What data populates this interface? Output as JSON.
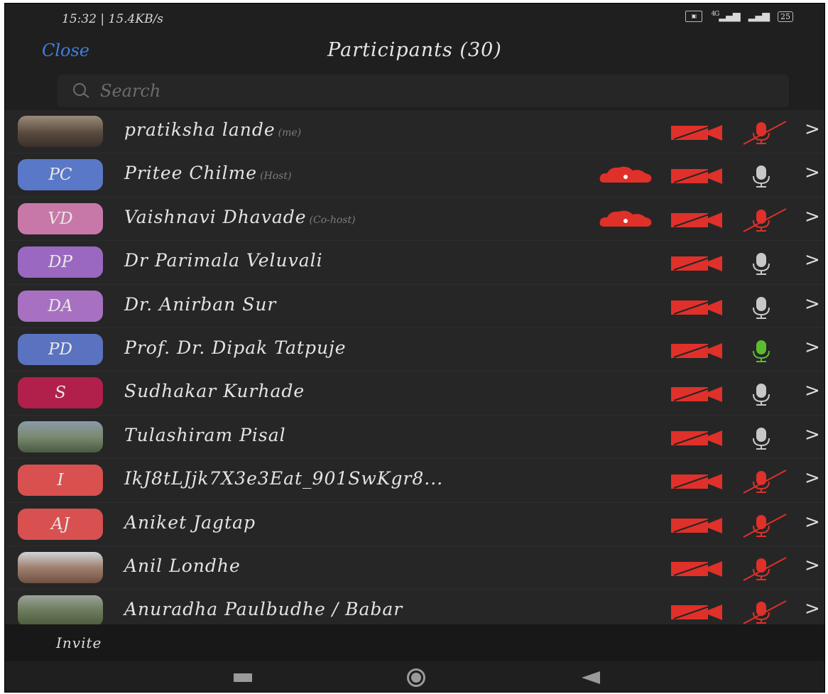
{
  "status_bar": {
    "time": "15:32 | 15.4KB/s",
    "network_label": "4G",
    "battery": "25"
  },
  "header": {
    "close_label": "Close",
    "title": "Participants (30)"
  },
  "search": {
    "placeholder": "Search"
  },
  "colors": {
    "accent_blue": "#3f7fe0",
    "muted_red": "#e0302a",
    "unmuted_gray": "#c8c8c8",
    "speaking_green": "#5bbd2e"
  },
  "participants": [
    {
      "initials": "",
      "avatar_color": "",
      "avatar_type": "photo",
      "name": "pratiksha lande",
      "role": "(me)",
      "recording": false,
      "mic": "muted"
    },
    {
      "initials": "PC",
      "avatar_color": "#5a78c8",
      "avatar_type": "initials",
      "name": "Pritee Chilme",
      "role": "(Host)",
      "recording": true,
      "mic": "unmuted"
    },
    {
      "initials": "VD",
      "avatar_color": "#c878a8",
      "avatar_type": "initials",
      "name": "Vaishnavi Dhavade",
      "role": "(Co-host)",
      "recording": true,
      "mic": "muted"
    },
    {
      "initials": "DP",
      "avatar_color": "#9a68c0",
      "avatar_type": "initials",
      "name": "Dr Parimala Veluvali",
      "role": "",
      "recording": false,
      "mic": "unmuted"
    },
    {
      "initials": "DA",
      "avatar_color": "#a870c0",
      "avatar_type": "initials",
      "name": "Dr. Anirban Sur",
      "role": "",
      "recording": false,
      "mic": "unmuted"
    },
    {
      "initials": "PD",
      "avatar_color": "#5a72c0",
      "avatar_type": "initials",
      "name": "Prof. Dr. Dipak Tatpuje",
      "role": "",
      "recording": false,
      "mic": "speaking"
    },
    {
      "initials": "S",
      "avatar_color": "#b0204a",
      "avatar_type": "initials",
      "name": "Sudhakar Kurhade",
      "role": "",
      "recording": false,
      "mic": "unmuted"
    },
    {
      "initials": "",
      "avatar_color": "",
      "avatar_type": "photo2",
      "name": "Tulashiram Pisal",
      "role": "",
      "recording": false,
      "mic": "unmuted"
    },
    {
      "initials": "I",
      "avatar_color": "#d85050",
      "avatar_type": "initials",
      "name": "IkJ8tLJjk7X3e3Eat_901SwKgr8...",
      "role": "",
      "recording": false,
      "mic": "muted"
    },
    {
      "initials": "AJ",
      "avatar_color": "#d85050",
      "avatar_type": "initials",
      "name": "Aniket Jagtap",
      "role": "",
      "recording": false,
      "mic": "muted"
    },
    {
      "initials": "",
      "avatar_color": "",
      "avatar_type": "photo3",
      "name": "Anil Londhe",
      "role": "",
      "recording": false,
      "mic": "muted"
    },
    {
      "initials": "",
      "avatar_color": "",
      "avatar_type": "photo4",
      "name": "Anuradha Paulbudhe / Babar",
      "role": "",
      "recording": false,
      "mic": "muted"
    }
  ],
  "footer": {
    "invite_label": "Invite"
  },
  "icons": {
    "camera": "camera-off-icon",
    "mic_muted": "mic-muted-icon",
    "mic_on": "mic-icon",
    "recording": "cloud-recording-icon",
    "chevron": "chevron-right-icon",
    "chevron_glyph": ">"
  }
}
